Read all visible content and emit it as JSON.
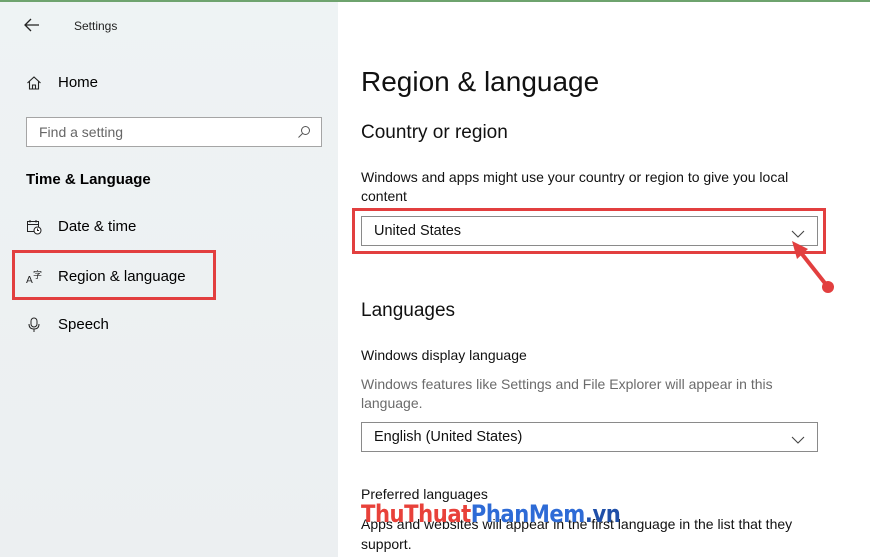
{
  "window": {
    "title": "Settings"
  },
  "sidebar": {
    "home_label": "Home",
    "search_placeholder": "Find a setting",
    "section_title": "Time & Language",
    "items": [
      {
        "label": "Date & time",
        "icon": "calendar-clock-icon"
      },
      {
        "label": "Region & language",
        "icon": "region-language-icon",
        "selected": true
      },
      {
        "label": "Speech",
        "icon": "microphone-icon"
      }
    ]
  },
  "main": {
    "title": "Region & language",
    "country": {
      "heading": "Country or region",
      "description": "Windows and apps might use your country or region to give you local content",
      "selected": "United States"
    },
    "languages": {
      "heading": "Languages",
      "display_label": "Windows display language",
      "display_description": "Windows features like Settings and File Explorer will appear in this language.",
      "display_selected": "English (United States)",
      "preferred_label": "Preferred languages",
      "preferred_description_partial": "Apps and websites will appear in the first language in the list that they support."
    }
  },
  "watermark": {
    "part1": "ThuThuat",
    "part2": "PhanMem",
    "part3": ".vn"
  },
  "colors": {
    "highlight": "#e23f3f",
    "accent": "#0078d7"
  }
}
